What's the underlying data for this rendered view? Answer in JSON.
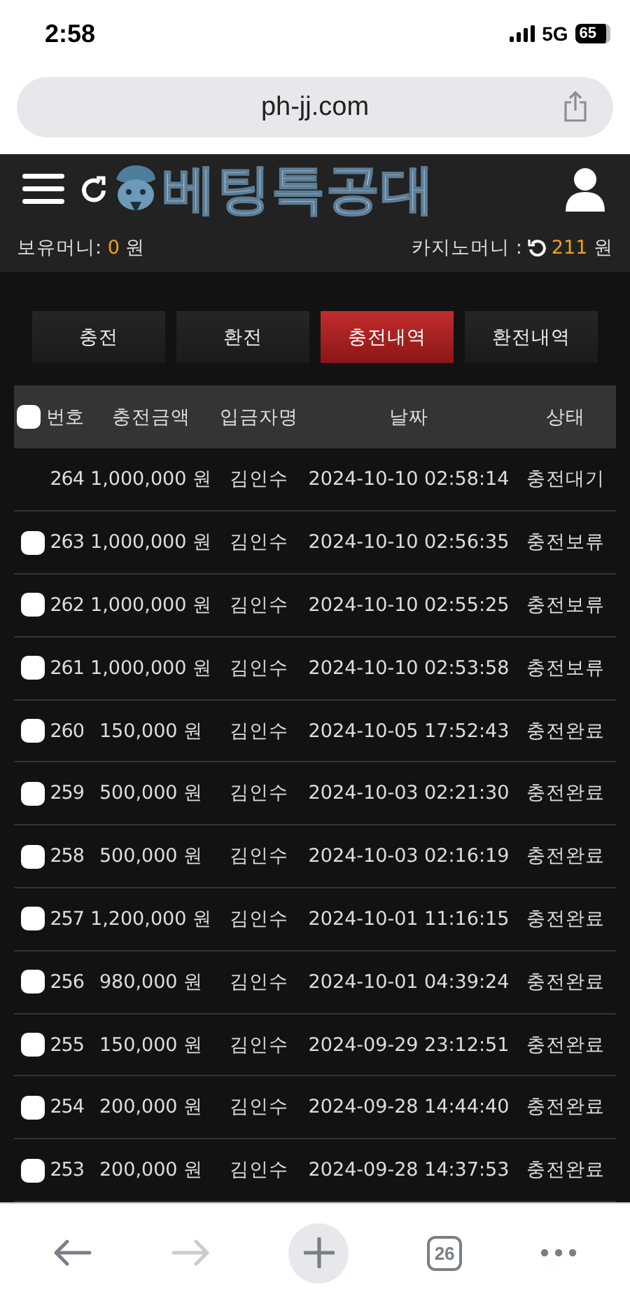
{
  "status_bar": {
    "time": "2:58",
    "network": "5G",
    "battery": "65"
  },
  "browser": {
    "url": "ph-jj.com"
  },
  "header": {
    "logo": "베팅특공대",
    "balance_label": "보유머니:",
    "balance_value": "0",
    "balance_unit": "원",
    "casino_label": "카지노머니 :",
    "casino_value": "211",
    "casino_unit": "원"
  },
  "tabs": [
    {
      "label": "충전",
      "selected": false
    },
    {
      "label": "환전",
      "selected": false
    },
    {
      "label": "충전내역",
      "selected": true
    },
    {
      "label": "환전내역",
      "selected": false
    }
  ],
  "table": {
    "select_all_checked": false,
    "columns": [
      "번호",
      "충전금액",
      "입금자명",
      "날짜",
      "상태"
    ],
    "rows": [
      {
        "kind": "plain",
        "cells": [
          "264",
          "1,000,000 원",
          "김인수",
          "2024-10-10 02:58:14",
          "충전대기"
        ]
      },
      {
        "kind": "selectable",
        "checked": false,
        "cells": [
          "263",
          "1,000,000 원",
          "김인수",
          "2024-10-10 02:56:35",
          "충전보류"
        ]
      },
      {
        "kind": "selectable",
        "checked": false,
        "cells": [
          "262",
          "1,000,000 원",
          "김인수",
          "2024-10-10 02:55:25",
          "충전보류"
        ]
      },
      {
        "kind": "selectable",
        "checked": false,
        "cells": [
          "261",
          "1,000,000 원",
          "김인수",
          "2024-10-10 02:53:58",
          "충전보류"
        ]
      },
      {
        "kind": "selectable",
        "checked": false,
        "cells": [
          "260",
          "150,000 원",
          "김인수",
          "2024-10-05 17:52:43",
          "충전완료"
        ]
      },
      {
        "kind": "selectable",
        "checked": false,
        "cells": [
          "259",
          "500,000 원",
          "김인수",
          "2024-10-03 02:21:30",
          "충전완료"
        ]
      },
      {
        "kind": "selectable",
        "checked": false,
        "cells": [
          "258",
          "500,000 원",
          "김인수",
          "2024-10-03 02:16:19",
          "충전완료"
        ]
      },
      {
        "kind": "selectable",
        "checked": false,
        "cells": [
          "257",
          "1,200,000 원",
          "김인수",
          "2024-10-01 11:16:15",
          "충전완료"
        ]
      },
      {
        "kind": "selectable",
        "checked": false,
        "cells": [
          "256",
          "980,000 원",
          "김인수",
          "2024-10-01 04:39:24",
          "충전완료"
        ]
      },
      {
        "kind": "selectable",
        "checked": false,
        "cells": [
          "255",
          "150,000 원",
          "김인수",
          "2024-09-29 23:12:51",
          "충전완료"
        ]
      },
      {
        "kind": "selectable",
        "checked": false,
        "cells": [
          "254",
          "200,000 원",
          "김인수",
          "2024-09-28 14:44:40",
          "충전완료"
        ]
      },
      {
        "kind": "selectable",
        "checked": false,
        "cells": [
          "253",
          "200,000 원",
          "김인수",
          "2024-09-28 14:37:53",
          "충전완료"
        ]
      }
    ]
  },
  "toolbar": {
    "back_disabled": false,
    "forward_disabled": true,
    "tab_count": "26"
  }
}
